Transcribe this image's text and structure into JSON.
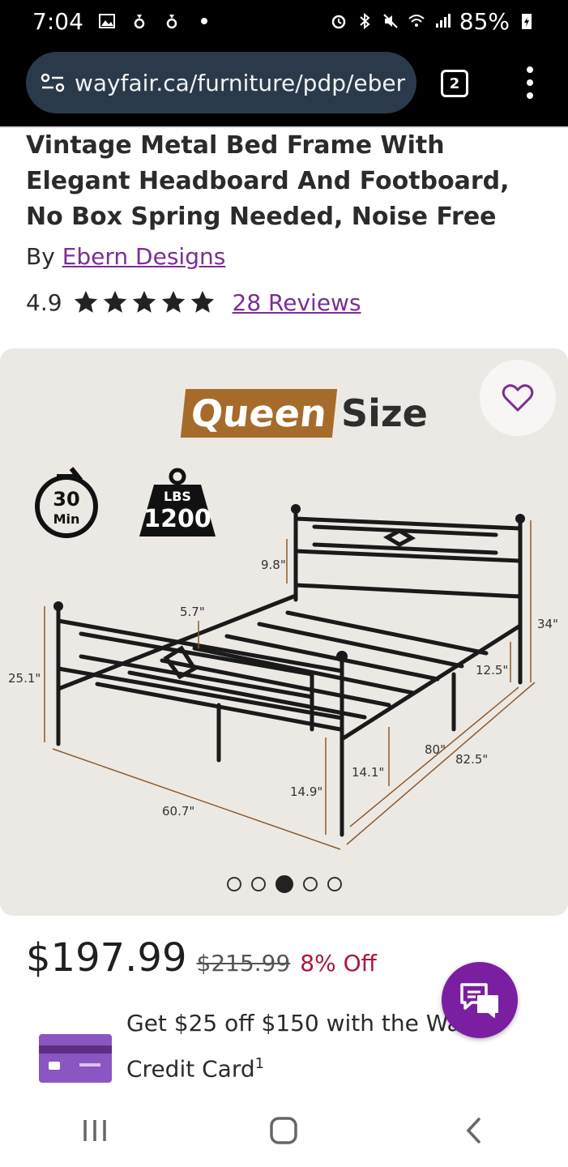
{
  "status_bar": {
    "time": "7:04",
    "battery": "85%"
  },
  "browser": {
    "url": "wayfair.ca/furniture/pdp/eber",
    "tab_count": "2"
  },
  "product": {
    "title": "Vintage Metal Bed Frame With Elegant Headboard And Footboard, No Box Spring Needed, Noise Free",
    "by_label": "By",
    "brand": "Ebern Designs",
    "rating": "4.9",
    "stars": 5,
    "reviews_label": "28 Reviews"
  },
  "image": {
    "badge_highlight": "Queen",
    "badge_text": "Size",
    "assembly_minutes": "30",
    "assembly_unit": "Min",
    "weight_unit": "LBS",
    "weight_capacity": "1200",
    "dimensions": {
      "headboard_gap": "9.8\"",
      "footboard_gap": "5.7\"",
      "headboard_height": "34\"",
      "footboard_height": "25.1\"",
      "slat_height": "12.5\"",
      "inner_length": "80\"",
      "outer_length": "82.5\"",
      "clearance_a": "14.1\"",
      "clearance_b": "14.9\"",
      "width": "60.7\""
    },
    "carousel_total": 5,
    "carousel_active": 3
  },
  "pricing": {
    "price": "$197.99",
    "old_price": "$215.99",
    "discount": "8% Off"
  },
  "promo": {
    "line1": "Get $25 off $150 with the Wa",
    "line2": "Credit Card",
    "footnote": "1"
  },
  "colors": {
    "brand_purple": "#7b2d96",
    "chat_purple": "#7b1fa2",
    "discount_red": "#b0143c",
    "badge_brown": "#a66b2b"
  }
}
